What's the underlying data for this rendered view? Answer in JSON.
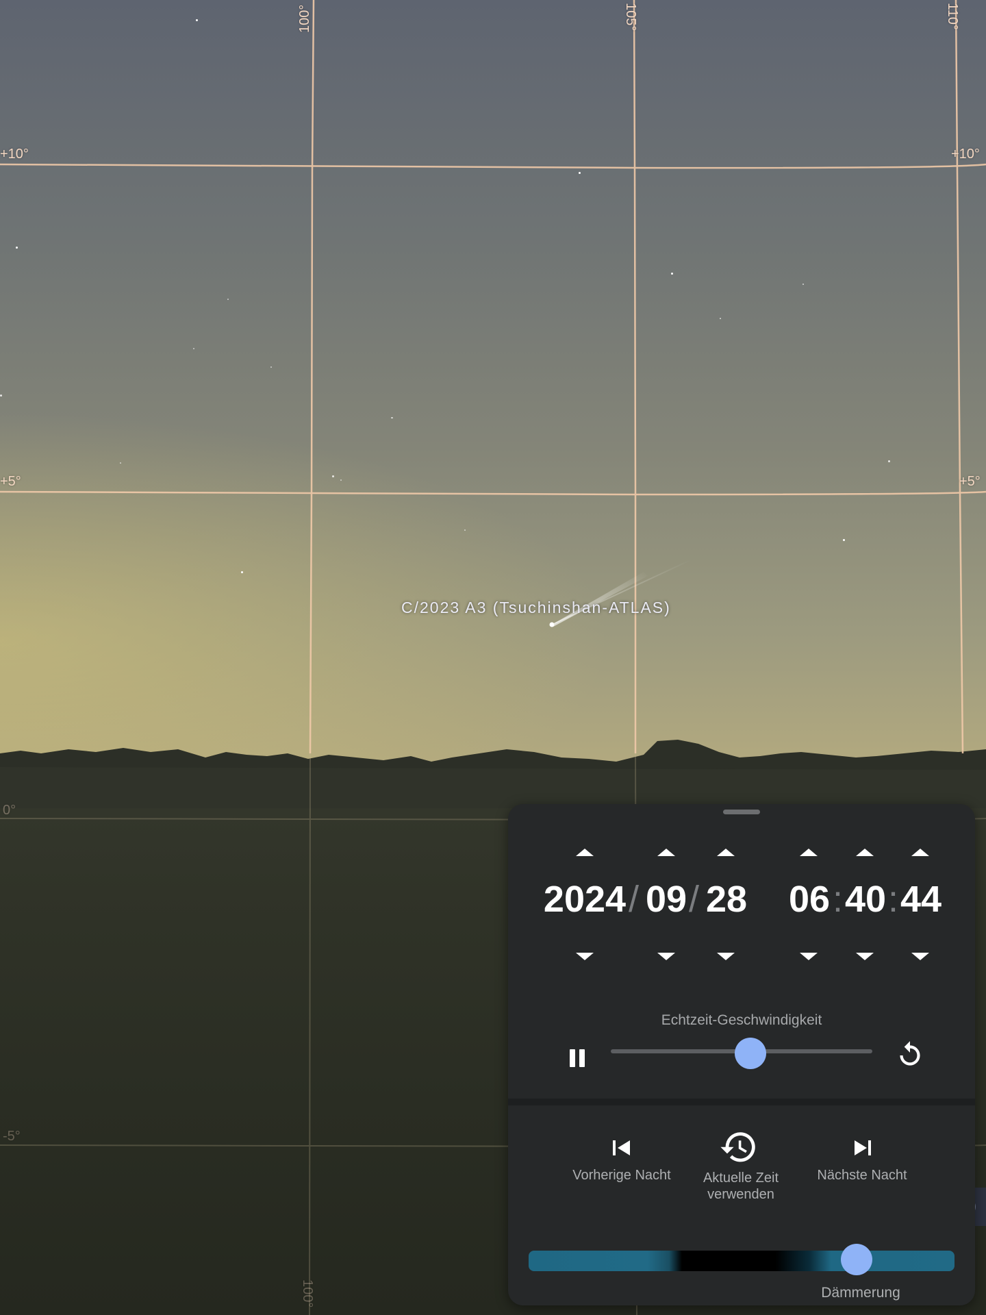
{
  "sky": {
    "grid_labels": {
      "ra_100": "100°",
      "ra_105": "105°",
      "ra_110": "110°",
      "dec_plus10_left": "+10°",
      "dec_plus10_right": "+10°",
      "dec_plus5_left": "+5°",
      "dec_plus5_right": "+5°",
      "dec_zero_left": "0°",
      "dec_minus5_left": "-5°",
      "ra_100_bottom": "100°"
    },
    "comet_label": "C/2023 A3 (Tsuchinshan-ATLAS)"
  },
  "time_panel": {
    "date": {
      "year": "2024",
      "month": "09",
      "day": "28",
      "separator": "/"
    },
    "time": {
      "hour": "06",
      "minute": "40",
      "second": "44",
      "separator": ":"
    },
    "speed_label": "Echtzeit-Geschwindigkeit",
    "speed_slider_level": 0.535,
    "previous_night_label": "Vorherige Nacht",
    "current_time_label_line1": "Aktuelle Zeit",
    "current_time_label_line2": "verwenden",
    "next_night_label": "Nächste Nacht",
    "twilight_label": "Dämmerung",
    "twilight_slider_level": 0.77
  },
  "colors": {
    "accent": "#8fb3f7",
    "panel_bg": "#262829",
    "grid_line": "#f0c9a8"
  }
}
